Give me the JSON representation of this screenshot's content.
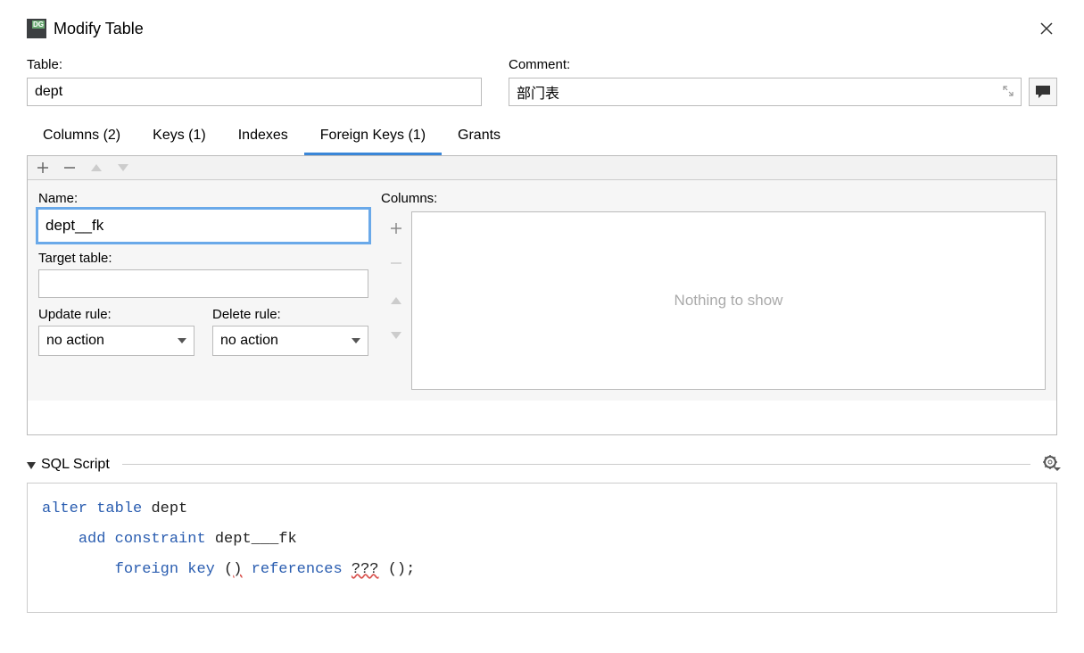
{
  "window": {
    "title": "Modify Table"
  },
  "fields": {
    "table_label": "Table:",
    "table_value": "dept",
    "comment_label": "Comment:",
    "comment_value": "部门表"
  },
  "tabs": {
    "columns": "Columns (2)",
    "keys": "Keys (1)",
    "indexes": "Indexes",
    "foreign_keys": "Foreign Keys (1)",
    "grants": "Grants"
  },
  "fk": {
    "name_label": "Name:",
    "name_value": "dept__fk",
    "target_label": "Target table:",
    "target_value": "",
    "update_label": "Update rule:",
    "update_value": "no action",
    "delete_label": "Delete rule:",
    "delete_value": "no action"
  },
  "cols": {
    "label": "Columns:",
    "empty": "Nothing to show"
  },
  "sql": {
    "title": "SQL Script",
    "tokens": {
      "alter": "alter",
      "table": "table",
      "dept": "dept",
      "add": "add",
      "constraint": "constraint",
      "fkname": "dept___fk",
      "foreign": "foreign",
      "key": "key",
      "references": "references",
      "unk": "???",
      "parens1": "()",
      "parens2": "();"
    }
  },
  "chart_data": null
}
